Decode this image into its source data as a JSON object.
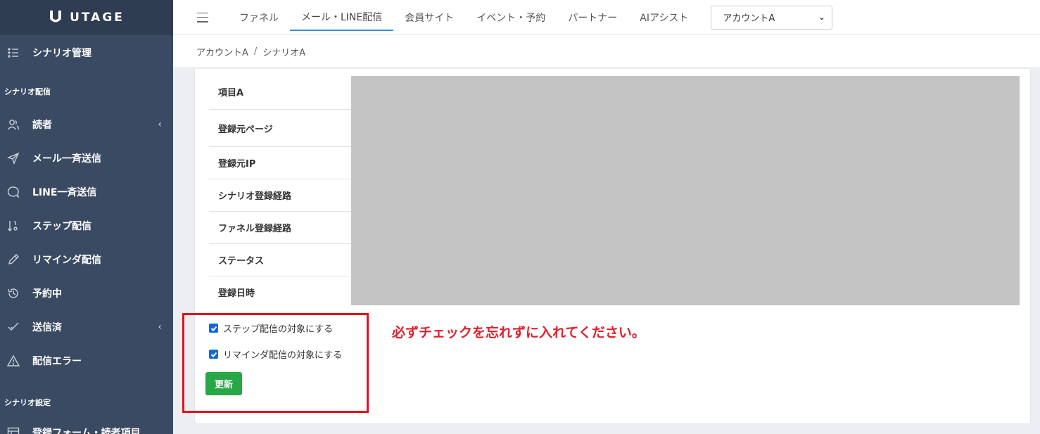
{
  "logo": {
    "text": "UTAGE"
  },
  "sidebar": {
    "top_item": {
      "label": "シナリオ管理",
      "icon": "list-icon"
    },
    "section1": "シナリオ配信",
    "items": [
      {
        "label": "読者",
        "icon": "users-icon",
        "chevron": "‹"
      },
      {
        "label": "メール一斉送信",
        "icon": "send-icon"
      },
      {
        "label": "LINE一斉送信",
        "icon": "chat-icon"
      },
      {
        "label": "ステップ配信",
        "icon": "sort-icon"
      },
      {
        "label": "リマインダ配信",
        "icon": "pencil-icon"
      },
      {
        "label": "予約中",
        "icon": "history-icon"
      },
      {
        "label": "送信済",
        "icon": "check-icon",
        "chevron": "‹"
      },
      {
        "label": "配信エラー",
        "icon": "warning-icon"
      }
    ],
    "section2": "シナリオ設定",
    "bottom_item": {
      "label": "登録フォーム・読者項目",
      "icon": "table-icon"
    }
  },
  "topnav": {
    "tabs": [
      "ファネル",
      "メール・LINE配信",
      "会員サイト",
      "イベント・予約",
      "パートナー",
      "AIアシスト"
    ],
    "active_tab": "メール・LINE配信",
    "account_select": "アカウントA"
  },
  "breadcrumb": {
    "account": "アカウントA",
    "separator": "/",
    "scenario": "シナリオA"
  },
  "fields": [
    "項目A",
    "登録元ページ",
    "登録元IP",
    "シナリオ登録経路",
    "ファネル登録経路",
    "ステータス",
    "登録日時"
  ],
  "options": {
    "step_label": "ステップ配信の対象にする",
    "remind_label": "リマインダ配信の対象にする",
    "update_button": "更新"
  },
  "annotation": "必ずチェックを忘れずに入れてください。",
  "colors": {
    "sidebar": "#3a4a62",
    "accent": "#3b8fd9",
    "button": "#27a745",
    "annotation": "#e2121e"
  }
}
